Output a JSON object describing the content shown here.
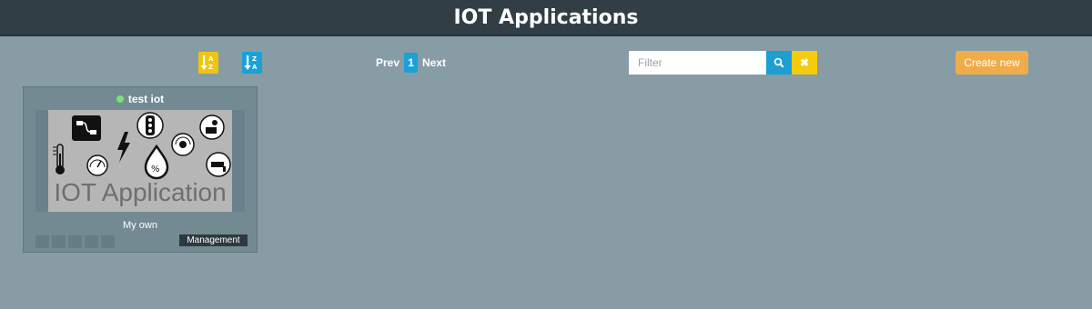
{
  "header": {
    "title": "IOT Applications"
  },
  "toolbar": {
    "sort_az_icon": "sort-alpha-asc-icon",
    "sort_za_icon": "sort-alpha-desc-icon",
    "prev_label": "Prev",
    "current_page": "1",
    "next_label": "Next",
    "filter_placeholder": "Filter",
    "filter_value": "",
    "search_icon": "search-icon",
    "clear_label": "✖",
    "create_label": "Create new"
  },
  "cards": [
    {
      "name": "test iot",
      "status_color": "#7ee07a",
      "image_caption": "IOT Application",
      "owner": "My own",
      "badge": "Management"
    }
  ],
  "colors": {
    "background": "#879ca5",
    "header": "#313e45",
    "sort_az": "#f1c40f",
    "sort_za": "#18a2d6",
    "search": "#1b9fd5",
    "clear": "#f5cc0c",
    "create": "#efac49"
  }
}
